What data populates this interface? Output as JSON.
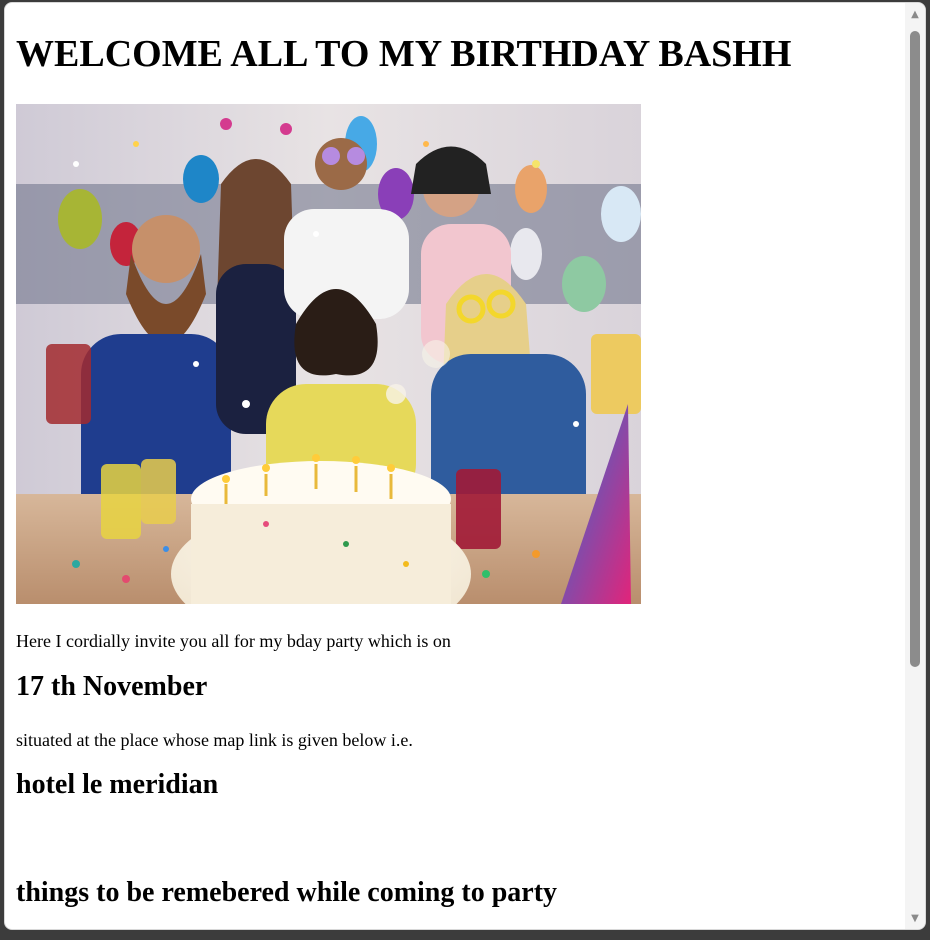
{
  "page": {
    "heading": "WELCOME ALL TO MY BIRTHDAY BASHH",
    "invite_text": "Here I cordially invite you all for my bday party which is on",
    "date": "17 th November",
    "location_text": "situated at the place whose map link is given below i.e.",
    "venue": "hotel le meridian",
    "things_heading": "things to be remebered while coming to party"
  },
  "image": {
    "subject": "birthday-party-photo"
  },
  "scrollbar": {
    "up_icon": "▲",
    "down_icon": "▼"
  }
}
